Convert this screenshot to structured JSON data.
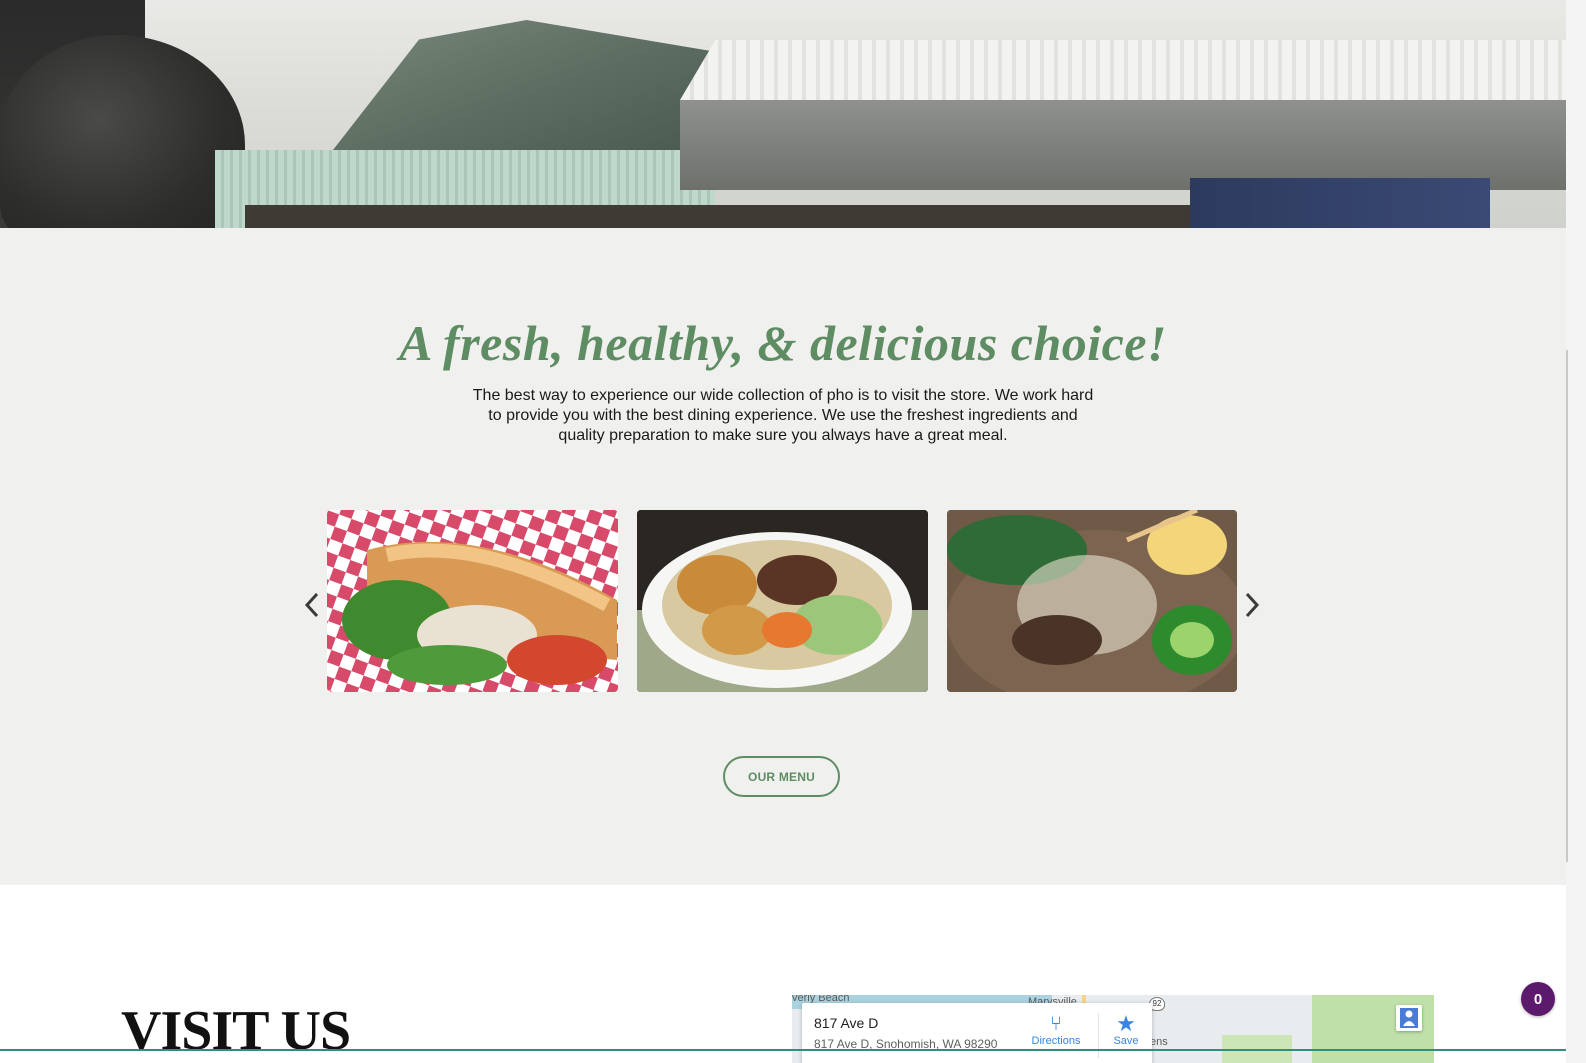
{
  "hero": {
    "alt": "Storefront awning"
  },
  "fresh": {
    "title": "A fresh, healthy, & delicious choice!",
    "description": "The best way to experience our wide collection of pho is to visit the store. We work hard to provide you with the best dining experience. We use the freshest ingredients and quality preparation to make sure you always have a great meal.",
    "menu_button_label": "OUR MENU",
    "slides": [
      {
        "icon": "banh-mi-sandwich-image"
      },
      {
        "icon": "vermicelli-bowl-image"
      },
      {
        "icon": "pho-soup-image"
      }
    ]
  },
  "visit": {
    "title": "VISIT US"
  },
  "map": {
    "place_title": "817 Ave D",
    "place_address": "817 Ave D, Snohomish, WA 98290",
    "directions_label": "Directions",
    "save_label": "Save",
    "label_beach": "verly Beach",
    "label_marysville": "Marysville",
    "label_ens": "ens",
    "highway": "92"
  },
  "cart": {
    "count": "0"
  },
  "colors": {
    "accent_green": "#5e8c63",
    "section_bg": "#f0f1ee",
    "cart_purple": "#5b1a6b",
    "map_link_blue": "#3a84df"
  }
}
